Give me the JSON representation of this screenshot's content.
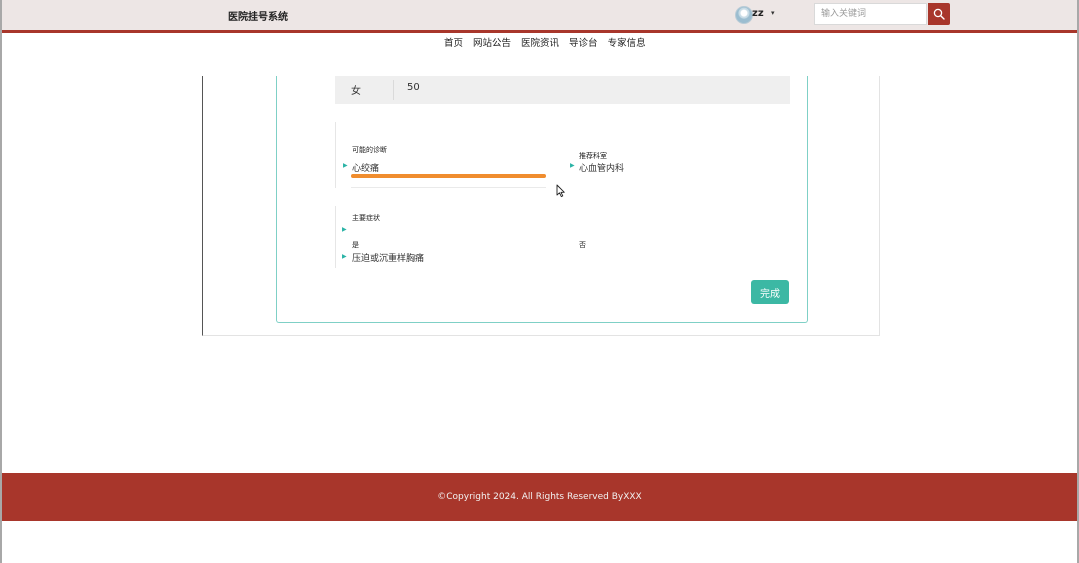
{
  "header": {
    "site_title": "医院挂号系统",
    "user_name": "zz",
    "caret_icon": "▾",
    "search": {
      "placeholder": "输入关键词",
      "value": ""
    }
  },
  "nav": {
    "items": [
      {
        "label": "首页"
      },
      {
        "label": "网站公告"
      },
      {
        "label": "医院资讯"
      },
      {
        "label": "导诊台"
      },
      {
        "label": "专家信息"
      }
    ]
  },
  "patient": {
    "gender": "女",
    "age": "50"
  },
  "diagnosis": {
    "label": "可能的诊断",
    "value": "心绞痛",
    "confidence_fraction": 1.0,
    "department_label": "推荐科室",
    "department_value": "心血管内科"
  },
  "symptoms": {
    "label": "主要症状",
    "yes_label": "是",
    "no_label": "否",
    "yes_value": "压迫或沉重样胸痛"
  },
  "actions": {
    "done_label": "完成"
  },
  "footer": {
    "copyright": "©Copyright 2024. All Rights Reserved ByXXX"
  },
  "colors": {
    "brand": "#a8362b",
    "accent": "#3cb8a4",
    "progress": "#f08d2e",
    "topbar_bg": "#ede6e5"
  },
  "icons": {
    "search": "search-icon",
    "avatar": "avatar",
    "arrow": "triangle-right-icon",
    "cursor": "mouse-cursor-icon"
  }
}
